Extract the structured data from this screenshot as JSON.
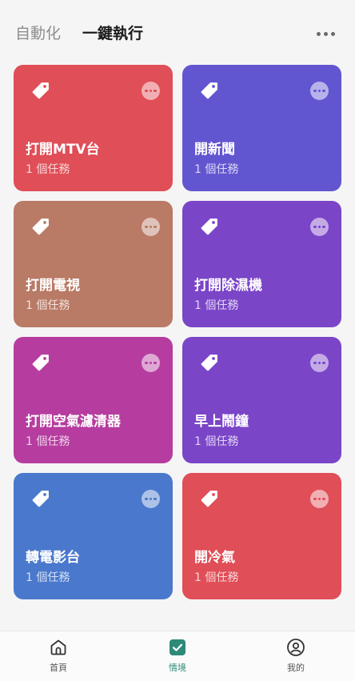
{
  "header": {
    "tab_automation": "自動化",
    "tab_one_tap": "一鍵執行",
    "more_icon": "more-horizontal-icon"
  },
  "cards": [
    {
      "title": "打開MTV台",
      "subtitle": "1 個任務",
      "color": "#e04e57",
      "icon": "tag-icon"
    },
    {
      "title": "開新聞",
      "subtitle": "1 個任務",
      "color": "#6256d0",
      "icon": "tag-icon"
    },
    {
      "title": "打開電視",
      "subtitle": "1 個任務",
      "color": "#b97a66",
      "icon": "tag-icon"
    },
    {
      "title": "打開除濕機",
      "subtitle": "1 個任務",
      "color": "#7b45c8",
      "icon": "tag-icon"
    },
    {
      "title": "打開空氣濾清器",
      "subtitle": "1 個任務",
      "color": "#b63d9f",
      "icon": "tag-icon"
    },
    {
      "title": "早上鬧鐘",
      "subtitle": "1 個任務",
      "color": "#7b45c8",
      "icon": "tag-icon"
    },
    {
      "title": "轉電影台",
      "subtitle": "1 個任務",
      "color": "#4a78cc",
      "icon": "tag-icon"
    },
    {
      "title": "開冷氣",
      "subtitle": "1 個任務",
      "color": "#e04e57",
      "icon": "tag-icon"
    }
  ],
  "bottom_nav": {
    "home_label": "首頁",
    "scenes_label": "情境",
    "me_label": "我的",
    "active_color": "#2e8a78"
  }
}
